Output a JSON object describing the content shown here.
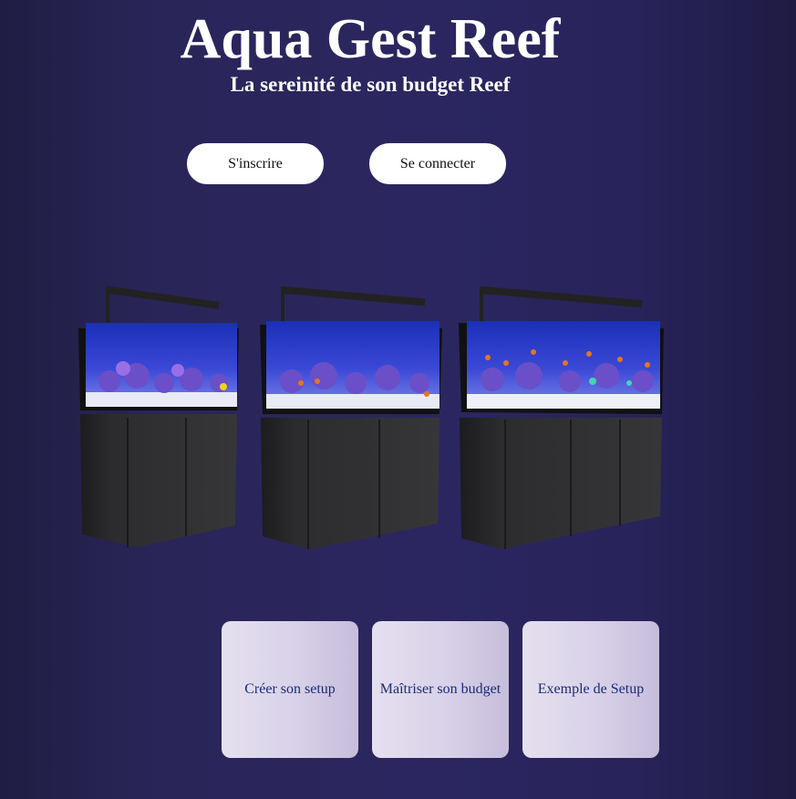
{
  "header": {
    "title": "Aqua Gest Reef",
    "subtitle": "La sereinité de son budget Reef"
  },
  "auth": {
    "signup_label": "S'inscrire",
    "login_label": "Se connecter"
  },
  "hero": {
    "images": [
      {
        "name": "aquarium-small"
      },
      {
        "name": "aquarium-medium"
      },
      {
        "name": "aquarium-large"
      }
    ]
  },
  "cards": [
    {
      "label": "Créer son setup"
    },
    {
      "label": "Maîtriser son budget"
    },
    {
      "label": "Exemple de Setup"
    }
  ],
  "colors": {
    "background": "#2b2660",
    "button_bg": "#ffffff",
    "card_text": "#1a2a7a"
  }
}
